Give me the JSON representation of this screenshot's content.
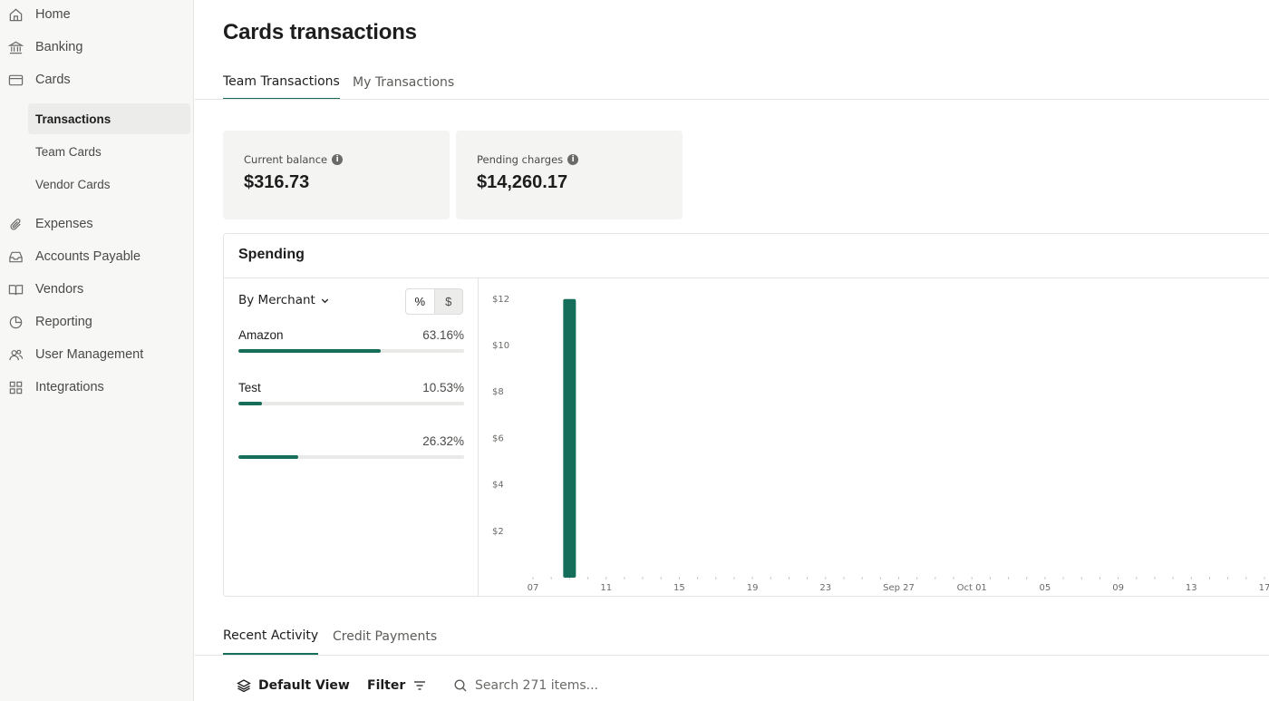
{
  "sidebar": {
    "items": [
      {
        "label": "Home",
        "icon": "home-icon"
      },
      {
        "label": "Banking",
        "icon": "bank-icon"
      },
      {
        "label": "Cards",
        "icon": "card-icon"
      },
      {
        "label": "Expenses",
        "icon": "paperclip-icon"
      },
      {
        "label": "Accounts Payable",
        "icon": "inbox-icon"
      },
      {
        "label": "Vendors",
        "icon": "book-icon"
      },
      {
        "label": "Reporting",
        "icon": "pie-chart-icon"
      },
      {
        "label": "User Management",
        "icon": "users-icon"
      },
      {
        "label": "Integrations",
        "icon": "grid-icon"
      }
    ],
    "cards_subitems": [
      {
        "label": "Transactions",
        "active": true
      },
      {
        "label": "Team Cards",
        "active": false
      },
      {
        "label": "Vendor Cards",
        "active": false
      }
    ]
  },
  "header": {
    "title": "Cards transactions",
    "tabs": [
      {
        "label": "Team Transactions",
        "active": true
      },
      {
        "label": "My Transactions",
        "active": false
      }
    ]
  },
  "balances": [
    {
      "label": "Current balance",
      "value": "$316.73"
    },
    {
      "label": "Pending charges",
      "value": "$14,260.17"
    }
  ],
  "spending": {
    "title": "Spending",
    "group_by": "By Merchant",
    "toggle": {
      "percent_label": "%",
      "dollar_label": "$",
      "selected": "percent"
    },
    "merchants": [
      {
        "name": "Amazon",
        "percent_label": "63.16%",
        "fraction": 0.6316
      },
      {
        "name": "Test",
        "percent_label": "10.53%",
        "fraction": 0.1053
      },
      {
        "name": "",
        "percent_label": "26.32%",
        "fraction": 0.2632
      }
    ]
  },
  "chart_data": {
    "type": "bar",
    "categories": [
      "07",
      "11",
      "15",
      "19",
      "23",
      "Sep 27",
      "Oct 01",
      "05",
      "09",
      "13",
      "17"
    ],
    "y_tick_labels": [
      "$12",
      "$10",
      "$8",
      "$6",
      "$4",
      "$2"
    ],
    "y_ticks": [
      12,
      10,
      8,
      6,
      4,
      2
    ],
    "ylim": [
      0,
      12.5
    ],
    "bars": [
      {
        "x_day_index": 2,
        "value": 12.0
      }
    ],
    "bar_color": "#156e5a",
    "grid": false,
    "title": "",
    "xlabel": "",
    "ylabel": ""
  },
  "activity": {
    "tabs": [
      {
        "label": "Recent Activity",
        "active": true
      },
      {
        "label": "Credit Payments",
        "active": false
      }
    ],
    "default_view_label": "Default View",
    "filter_label": "Filter",
    "search_placeholder": "Search 271 items..."
  },
  "colors": {
    "accent": "#156e5a",
    "sidebar_bg": "#f7f7f6",
    "card_bg": "#f4f4f3"
  }
}
